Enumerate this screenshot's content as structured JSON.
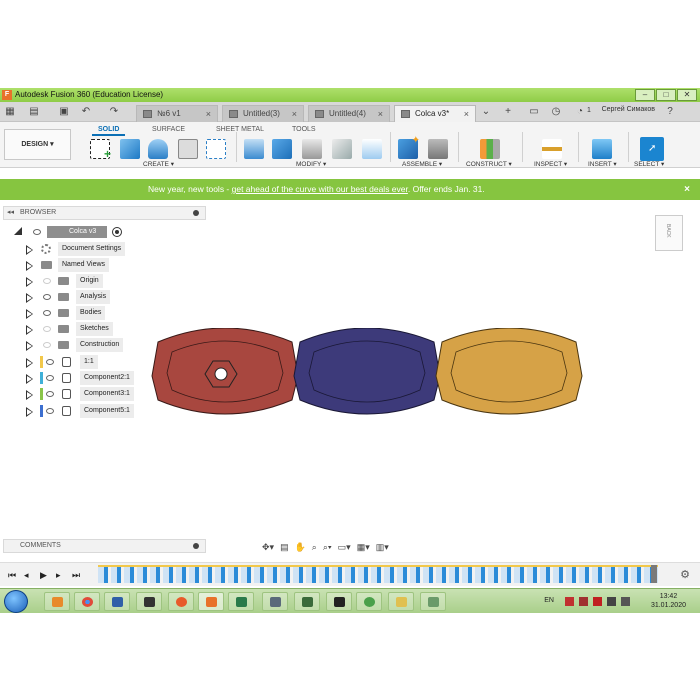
{
  "title": "Autodesk Fusion 360 (Education License)",
  "tabs": [
    {
      "label": "№6 v1",
      "active": false
    },
    {
      "label": "Untitled(3)",
      "active": false
    },
    {
      "label": "Untitled(4)",
      "active": false
    },
    {
      "label": "Colca v3*",
      "active": true
    }
  ],
  "notif_count": "1",
  "user_name": "Сергей Симаков",
  "workspace": "DESIGN",
  "ws_tabs": [
    "SOLID",
    "SURFACE",
    "SHEET METAL",
    "TOOLS"
  ],
  "groups": [
    "CREATE",
    "MODIFY",
    "ASSEMBLE",
    "CONSTRUCT",
    "INSPECT",
    "INSERT",
    "SELECT"
  ],
  "banner": {
    "prefix": "New year, new tools - ",
    "link": "get ahead of the curve with our best deals ever",
    "suffix": ". Offer ends Jan. 31.",
    "close": "×"
  },
  "browser": {
    "title": "BROWSER",
    "root": "Colca v3",
    "items": [
      "Document Settings",
      "Named Views",
      "Origin",
      "Analysis",
      "Bodies",
      "Sketches",
      "Construction",
      "1:1",
      "Component2:1",
      "Component3:1",
      "Component5:1"
    ]
  },
  "comments": "COMMENTS",
  "viewcube_label": "BACK",
  "component_colors": [
    "#f2c84b",
    "#40b0d8",
    "#8ac54a",
    "#3c6fd0"
  ],
  "part_colors": [
    "#a8473f",
    "#3d3a7a",
    "#d6a247"
  ],
  "taskbar": {
    "lang": "EN",
    "time": "13:42",
    "date": "31.01.2020"
  }
}
